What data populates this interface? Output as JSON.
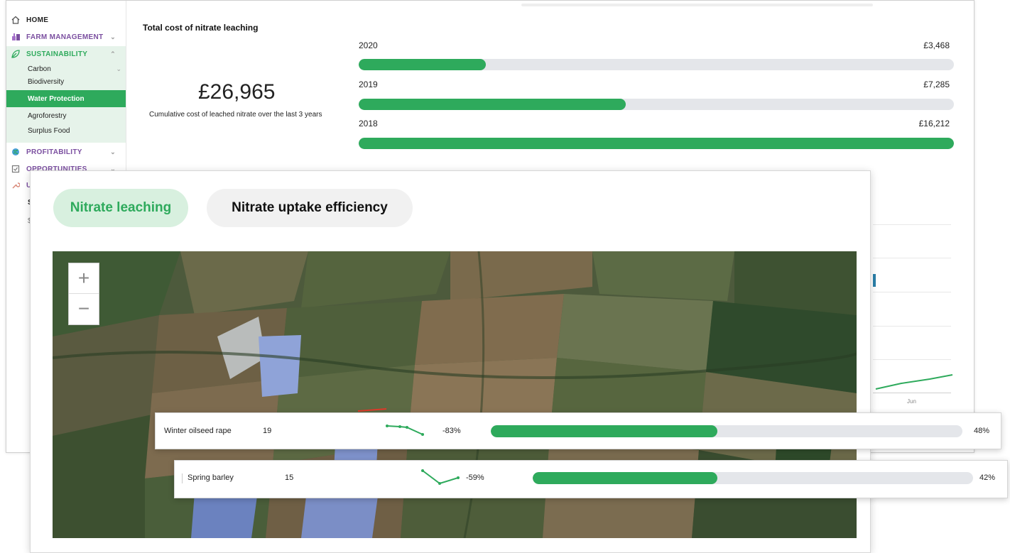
{
  "colors": {
    "accent": "#2eaa5c",
    "accent_light": "#d8f0df",
    "track": "#e4e6ea",
    "nav_purple": "#7b4fa0",
    "nav_green": "#2eaa5c"
  },
  "sidebar": {
    "home": "HOME",
    "farm_management": "FARM MANAGEMENT",
    "sustainability": "SUSTAINABILITY",
    "sub_items": [
      "Carbon",
      "Biodiversity",
      "Water Protection",
      "Agroforestry",
      "Surplus Food"
    ],
    "active_sub_item": "Water Protection",
    "profitability": "PROFITABILITY",
    "opportunities": "OPPORTUNITIES",
    "partial_items": [
      "U",
      "S",
      "$"
    ]
  },
  "cost_panel": {
    "title": "Total cost of nitrate leaching",
    "total": "£26,965",
    "caption": "Cumulative cost of leached nitrate over the last 3 years",
    "years": [
      {
        "year": "2020",
        "value": "£3,468",
        "fraction": 0.214
      },
      {
        "year": "2019",
        "value": "£7,285",
        "fraction": 0.449
      },
      {
        "year": "2018",
        "value": "£16,212",
        "fraction": 1.0
      }
    ]
  },
  "background_chart": {
    "x_tick": "Jun"
  },
  "tabs": {
    "active": "Nitrate leaching",
    "inactive": "Nitrate uptake efficiency"
  },
  "map": {
    "zoom_in": "+",
    "zoom_out": "−"
  },
  "crops": [
    {
      "name": "Winter oilseed rape",
      "count": "19",
      "change": "-83%",
      "percent": "48%",
      "fraction": 0.48
    },
    {
      "name": "Spring barley",
      "count": "15",
      "change": "-59%",
      "percent": "42%",
      "fraction": 0.42
    }
  ]
}
